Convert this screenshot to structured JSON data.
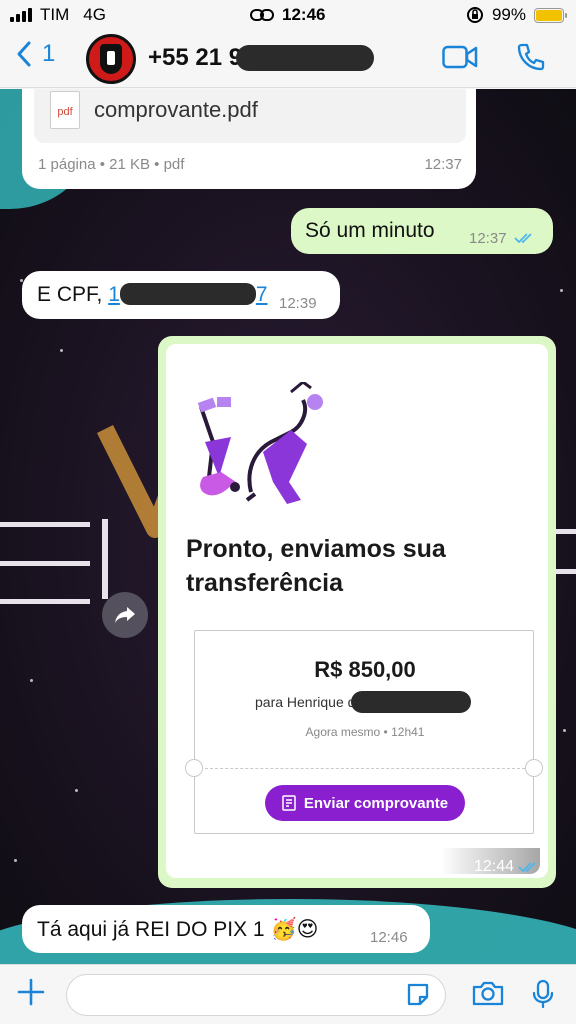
{
  "status_bar": {
    "carrier": "TIM",
    "network": "4G",
    "time": "12:46",
    "battery": "99%",
    "battery_color": "#f2c200"
  },
  "header": {
    "back_count": "1",
    "contact_number": "+55 21 9",
    "icons": [
      "chevron-left-icon",
      "video-call-icon",
      "phone-icon"
    ],
    "accent_color": "#1a85d8"
  },
  "messages": [
    {
      "type": "document",
      "direction": "incoming",
      "filename": "comprovante.pdf",
      "icon_label": "pdf",
      "meta": "1 página • 21 KB • pdf",
      "time": "12:37"
    },
    {
      "type": "text",
      "direction": "outgoing",
      "text": "Só um minuto",
      "time": "12:37",
      "status": "read"
    },
    {
      "type": "text",
      "direction": "incoming",
      "prefix": "E CPF, ",
      "link_start": "1",
      "link_end": "7",
      "time": "12:39"
    },
    {
      "type": "image",
      "direction": "outgoing",
      "headline": "Pronto, enviamos sua transferência",
      "amount": "R$ 850,00",
      "recipient_prefix": "para Henrique d",
      "when": "Agora mesmo • 12h41",
      "button_label": "Enviar comprovante",
      "button_color": "#8a1fcf",
      "time": "12:44",
      "status": "read"
    },
    {
      "type": "text",
      "direction": "incoming",
      "text": "Tá aqui já REI DO PIX 1",
      "emojis": [
        "🥳",
        "😍"
      ],
      "time": "12:46"
    }
  ],
  "input_bar": {
    "placeholder": "",
    "icons": [
      "plus-icon",
      "sticker-icon",
      "camera-icon",
      "microphone-icon"
    ]
  },
  "colors": {
    "outgoing_bubble": "#dcf8c6",
    "incoming_bubble": "#ffffff",
    "read_ticks": "#4fb6ec"
  }
}
